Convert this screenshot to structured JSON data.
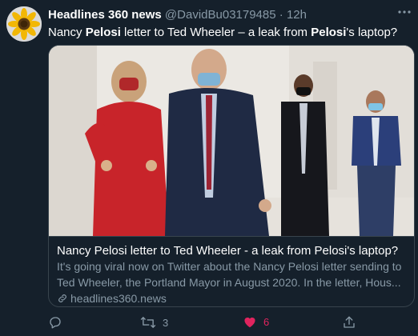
{
  "tweet": {
    "display_name": "Headlines 360 news",
    "handle": "@DavidBu03179485",
    "separator": "·",
    "time": "12h",
    "text_parts": [
      "Nancy ",
      "Pelosi",
      " letter to Ted Wheeler – a leak from ",
      "Pelosi",
      "'s laptop?"
    ]
  },
  "card": {
    "title": "Nancy Pelosi letter to Ted Wheeler - a leak from Pelosi's laptop?",
    "description_line1": "It's going viral now on Twitter about the Nancy Pelosi letter sending to",
    "description_line2": "Ted Wheeler, the Portland Mayor in August 2020. In the letter, Hous...",
    "domain": "headlines360.news"
  },
  "actions": {
    "reply_count": "",
    "retweet_count": "3",
    "like_count": "6",
    "share_count": ""
  },
  "icons": {
    "avatar": "sunflower-avatar",
    "more": "more-dots-icon",
    "link": "link-icon",
    "reply": "reply-icon",
    "retweet": "retweet-icon",
    "like": "heart-icon",
    "share": "share-icon"
  },
  "colors": {
    "background": "#15202b",
    "border": "#38444d",
    "secondary_text": "#8899a6",
    "like": "#e0245e"
  }
}
